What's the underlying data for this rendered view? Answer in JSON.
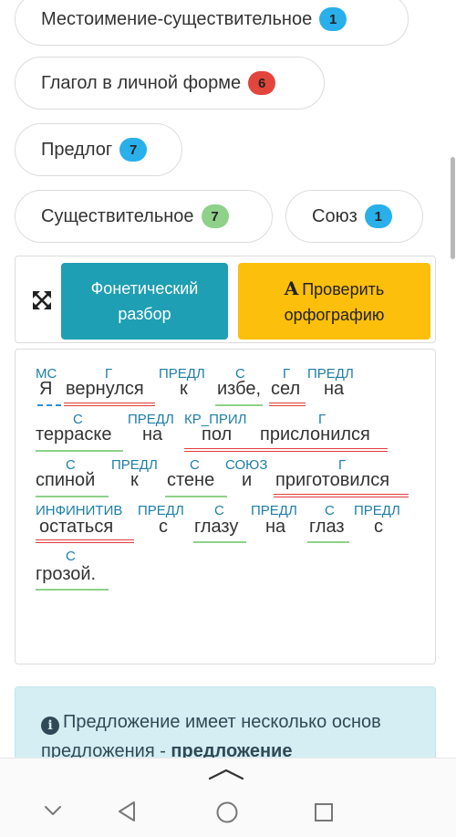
{
  "chips": [
    {
      "label": "Местоимение-существительное",
      "count": "1",
      "color": "#29b0ea"
    },
    {
      "label": "Глагол в личной форме",
      "count": "6",
      "color": "#e2453c"
    },
    {
      "label": "Предлог",
      "count": "7",
      "color": "#29b0ea"
    },
    {
      "label": "Существительное",
      "count": "7",
      "color": "#8fd18a"
    },
    {
      "label": "Союз",
      "count": "1",
      "color": "#29b0ea"
    }
  ],
  "toolbar": {
    "phonetic_line1": "Фонетический",
    "phonetic_line2": "разбор",
    "spell_icon": "A",
    "spell_line1": "Проверить",
    "spell_line2": "орфографию"
  },
  "sentence": {
    "words": [
      "Я",
      "вернулся",
      "к",
      "избе,",
      "сел",
      "на",
      "терраске",
      "на",
      "пол",
      "прислонился",
      "спиной",
      "к",
      "стене",
      "и",
      "приготовился",
      "остаться",
      "с",
      "глазу",
      "на",
      "глаз",
      "с",
      "грозой."
    ],
    "tags": [
      "МС",
      "Г",
      "ПРЕДЛ",
      "С",
      "Г",
      "ПРЕДЛ",
      "С",
      "ПРЕДЛ",
      "КР_ПРИЛ",
      "Г",
      "С",
      "ПРЕДЛ",
      "С",
      "СОЮЗ",
      "Г",
      "ИНФИНИТИВ",
      "ПРЕДЛ",
      "С",
      "ПРЕДЛ",
      "С",
      "ПРЕДЛ",
      "С"
    ]
  },
  "info": {
    "icon": "i",
    "text": "Предложение имеет несколько основ предложения - ",
    "bold": "предложение"
  },
  "nav": {
    "icons": [
      "collapse-up-icon",
      "chevron-down-icon",
      "back-icon",
      "home-icon",
      "recents-icon"
    ]
  }
}
